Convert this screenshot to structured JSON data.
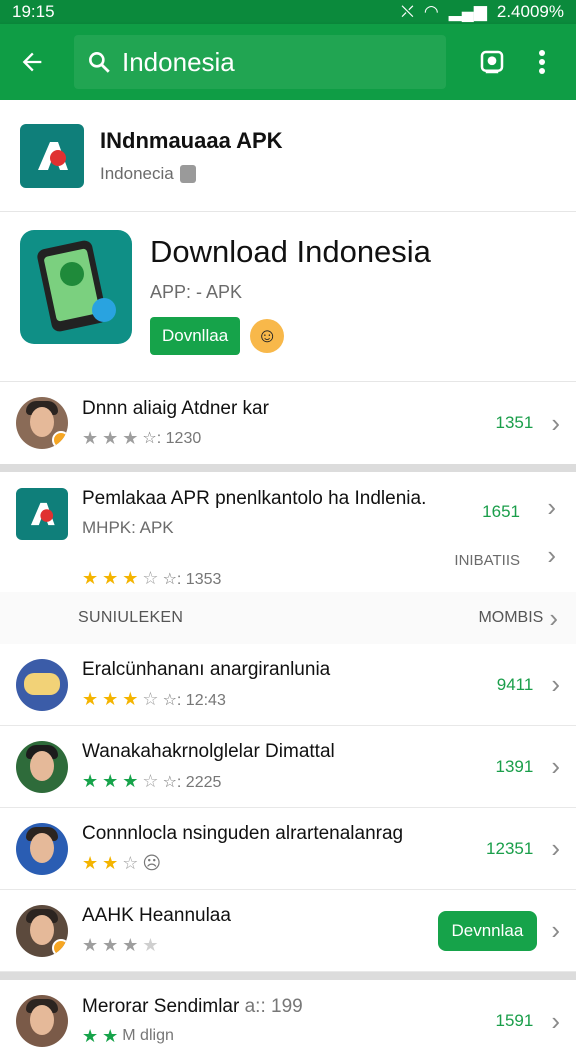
{
  "status": {
    "time": "19:15",
    "battery": "2.4009%"
  },
  "appbar": {
    "search_text": "Indonesia"
  },
  "top_app": {
    "name": "INdnmauaaa APK",
    "sub": "Indonecia"
  },
  "hero": {
    "title": "Download Indonesia",
    "sub": "APP: - APK",
    "button": "Dovnllaa"
  },
  "row1": {
    "name": "Dnnn aliaig Atdner kar",
    "meta": "☆: 1230",
    "count": "1351"
  },
  "big": {
    "name": "Pemlakaa APR pnenlkantolo ha Indlenia.",
    "sub": "MHPK: APK",
    "meta": "☆: 1353",
    "count": "1651",
    "detail": "INIBATIIS"
  },
  "section": {
    "label": "SUNIULEKEN",
    "more": "MOMBIS"
  },
  "list": [
    {
      "name": "Eralcünhananı anargiranlunia",
      "meta": "☆: 12:43",
      "count": "9411"
    },
    {
      "name": "Wanakahakrnolglelar Dimattal",
      "meta": "☆: 2225",
      "count": "1391"
    },
    {
      "name": "Connnlocla nsinguden alrartenalanrag",
      "meta": "",
      "count": "12351"
    },
    {
      "name": "AAHK Heannulaa",
      "meta": "",
      "button": "Devnnlaa"
    },
    {
      "name": "Merorar Sendimlar",
      "meta": "a:: 199",
      "count": "1591",
      "sub": "M dlign"
    }
  ]
}
